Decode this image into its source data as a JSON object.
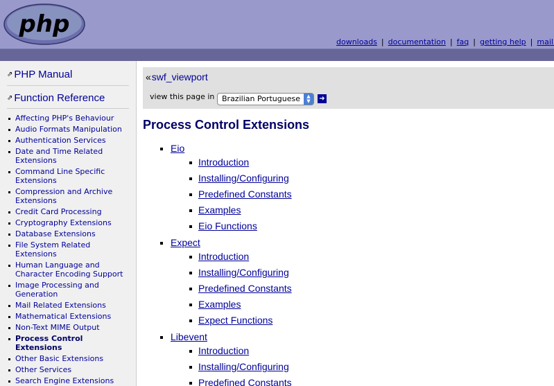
{
  "header": {
    "logo_text": "php",
    "nav": [
      "downloads",
      "documentation",
      "faq",
      "getting help",
      "mailing li"
    ]
  },
  "sidebar": {
    "home_label": "PHP Manual",
    "section_label": "Function Reference",
    "items": [
      "Affecting PHP's Behaviour",
      "Audio Formats Manipulation",
      "Authentication Services",
      "Date and Time Related Extensions",
      "Command Line Specific Extensions",
      "Compression and Archive Extensions",
      "Credit Card Processing",
      "Cryptography Extensions",
      "Database Extensions",
      "File System Related Extensions",
      "Human Language and Character Encoding Support",
      "Image Processing and Generation",
      "Mail Related Extensions",
      "Mathematical Extensions",
      "Non-Text MIME Output",
      "Process Control Extensions",
      "Other Basic Extensions",
      "Other Services",
      "Search Engine Extensions"
    ],
    "active_item": "Process Control Extensions"
  },
  "content": {
    "prev_link": "swf_viewport",
    "view_label": "view this page in",
    "language_selected": "Brazilian Portuguese",
    "title": "Process Control Extensions",
    "chapters": [
      {
        "name": "Eio",
        "sections": [
          "Introduction",
          "Installing/Configuring",
          "Predefined Constants",
          "Examples",
          "Eio Functions"
        ]
      },
      {
        "name": "Expect",
        "sections": [
          "Introduction",
          "Installing/Configuring",
          "Predefined Constants",
          "Examples",
          "Expect Functions"
        ]
      },
      {
        "name": "Libevent",
        "sections": [
          "Introduction",
          "Installing/Configuring",
          "Predefined Constants"
        ]
      }
    ]
  },
  "colors": {
    "header_bg": "#9999cc",
    "header_bar": "#666699",
    "link": "#000099",
    "title": "#000066",
    "sidebar_bg": "#f0f0f0"
  },
  "icons": {
    "home": "double-chevron-up-icon",
    "section": "double-chevron-up-icon",
    "prev": "double-chevron-left-icon",
    "go": "arrow-right-icon"
  }
}
